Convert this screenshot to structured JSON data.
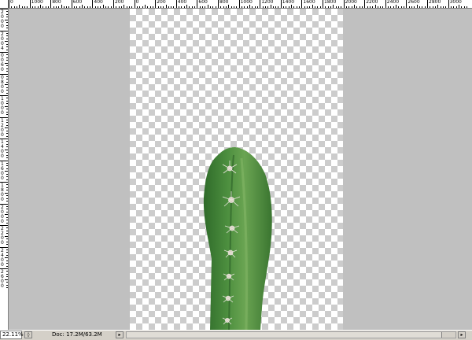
{
  "ruler_h": {
    "labels": [
      "0",
      "1000",
      "800",
      "600",
      "400",
      "200",
      "0",
      "200",
      "400",
      "600",
      "800",
      "1000",
      "1200",
      "1400",
      "1600",
      "1800",
      "2000",
      "2200",
      "2400",
      "2600",
      "2800",
      "3000"
    ]
  },
  "ruler_v": {
    "labels": [
      "2",
      "0",
      "0",
      "0",
      "2",
      "0",
      "0",
      "4",
      "0",
      "0",
      "6",
      "0",
      "0",
      "8",
      "0",
      "0",
      "1",
      "0",
      "0",
      "0",
      "1",
      "2",
      "0",
      "0",
      "1",
      "4",
      "0",
      "0",
      "1",
      "6",
      "0",
      "0",
      "1",
      "8",
      "0",
      "0",
      "2",
      "0",
      "0",
      "0",
      "2",
      "2",
      "0",
      "0",
      "2",
      "4",
      "0",
      "0",
      "2",
      "6",
      "0",
      "0"
    ]
  },
  "status": {
    "zoom": "22.11%",
    "doc": "Doc: 17.2M/63.2M"
  },
  "colors": {
    "workspace": "#c0c0c0",
    "cactus_green": "#3f7f34"
  }
}
